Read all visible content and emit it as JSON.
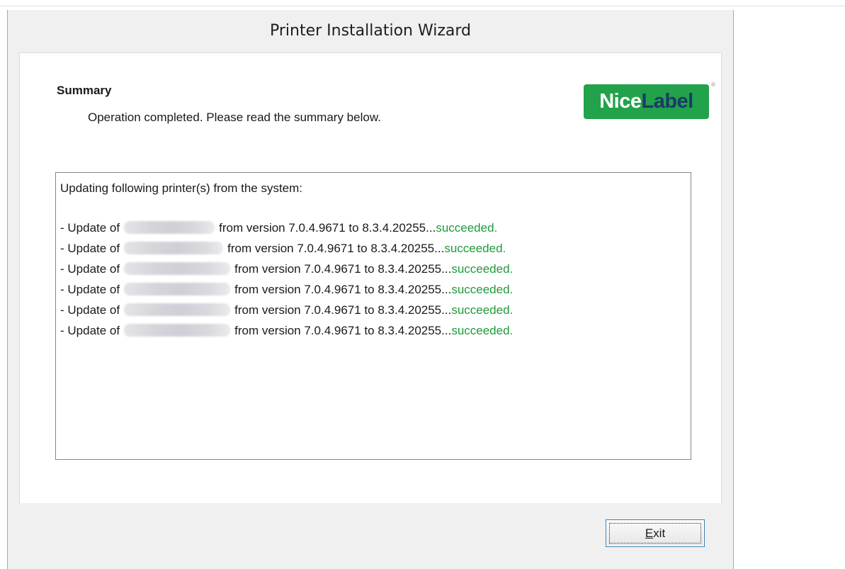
{
  "window": {
    "title": "Printer Installation Wizard"
  },
  "header": {
    "heading": "Summary",
    "subheading": "Operation completed. Please read the summary below.",
    "logo": {
      "nice": "Nice",
      "label": "Label",
      "reg": "®"
    }
  },
  "summary": {
    "intro": "Updating following printer(s) from the system:",
    "rows": [
      {
        "prefix": "- Update of",
        "detail": "from version 7.0.4.9671 to 8.3.4.20255...",
        "status": "succeeded."
      },
      {
        "prefix": "- Update of",
        "detail": "from version 7.0.4.9671 to 8.3.4.20255...",
        "status": "succeeded."
      },
      {
        "prefix": "- Update of",
        "detail": "from version 7.0.4.9671 to 8.3.4.20255...",
        "status": "succeeded."
      },
      {
        "prefix": "- Update of",
        "detail": "from version 7.0.4.9671 to 8.3.4.20255...",
        "status": "succeeded."
      },
      {
        "prefix": "- Update of",
        "detail": "from version 7.0.4.9671 to 8.3.4.20255...",
        "status": "succeeded."
      },
      {
        "prefix": "- Update of",
        "detail": "from version 7.0.4.9671 to 8.3.4.20255...",
        "status": "succeeded."
      }
    ]
  },
  "footer": {
    "exit_label": "Exit"
  },
  "colors": {
    "success": "#1f9a3a",
    "logo_green": "#22a24a",
    "logo_navy": "#1b3a66"
  }
}
